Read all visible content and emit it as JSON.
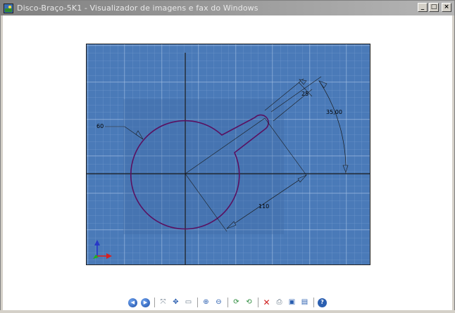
{
  "window": {
    "title": "Disco-Braço-5K1 - Visualizador de imagens e fax do Windows",
    "minimize_glyph": "_",
    "maximize_glyph": "□",
    "close_glyph": "×"
  },
  "drawing": {
    "background_color": "#4a7ab8",
    "grid_color": "#8fb0d9",
    "line_color": "#1a1a1a",
    "profile_color": "#5a1060",
    "dimensions": {
      "radius_label": "60",
      "slot_width_label": "25",
      "angle_label": "35,00",
      "length_label": "110"
    }
  },
  "toolbar": {
    "buttons": [
      {
        "name": "previous-image-button",
        "icon": "previous-icon"
      },
      {
        "name": "next-image-button",
        "icon": "next-icon"
      },
      {
        "name": "best-fit-button",
        "icon": "best-fit-icon"
      },
      {
        "name": "actual-size-button",
        "icon": "actual-size-icon"
      },
      {
        "name": "slideshow-button",
        "icon": "slideshow-icon"
      },
      {
        "name": "zoom-in-button",
        "icon": "zoom-in-icon"
      },
      {
        "name": "zoom-out-button",
        "icon": "zoom-out-icon"
      },
      {
        "name": "rotate-clockwise-button",
        "icon": "rotate-clockwise-icon"
      },
      {
        "name": "rotate-counterclockwise-button",
        "icon": "rotate-counterclockwise-icon"
      },
      {
        "name": "delete-button",
        "icon": "delete-icon"
      },
      {
        "name": "print-button",
        "icon": "print-icon"
      },
      {
        "name": "save-button",
        "icon": "save-icon"
      },
      {
        "name": "open-editor-button",
        "icon": "edit-image-icon"
      },
      {
        "name": "help-button",
        "icon": "help-icon"
      }
    ]
  }
}
